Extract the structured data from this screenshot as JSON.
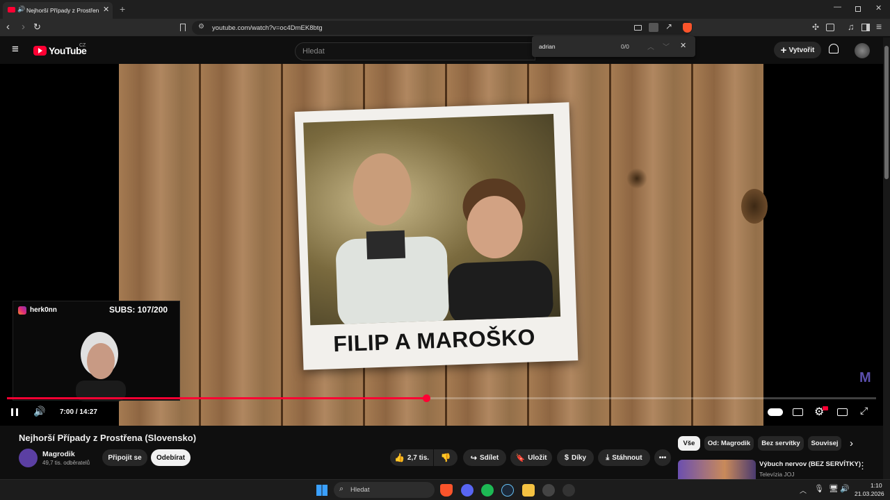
{
  "browser": {
    "tab_title": "Nejhorší Případy z Prostřena",
    "url": "youtube.com/watch?v=oc4DmEK8btg"
  },
  "find_bar": {
    "query": "adrian",
    "count": "0/0"
  },
  "youtube": {
    "logo_text": "YouTube",
    "region": "CZ",
    "search_placeholder": "Hledat",
    "create_label": "Vytvořit"
  },
  "video": {
    "card_caption": "FILIP A MAROŠKO",
    "time": "7:00 / 14:27",
    "progress": 0.482,
    "title": "Nejhorší Případy z Prostřena (Slovensko)"
  },
  "overlay": {
    "streamer": "herk0nn",
    "subs": "SUBS: 107/200"
  },
  "channel": {
    "name": "Magrodik",
    "subscribers": "49,7 tis. odběratelů",
    "join_label": "Připojit se",
    "subscribe_label": "Odebírat"
  },
  "actions": {
    "likes": "2,7 tis.",
    "share": "Sdílet",
    "save": "Uložit",
    "thanks": "Díky",
    "download": "Stáhnout"
  },
  "chips": [
    "Vše",
    "Od: Magrodik",
    "Bez servítky",
    "Souvisej"
  ],
  "recommendation": {
    "title": "Výbuch nervov (BEZ SERVÍTKY)",
    "channel": "Televízia JOJ"
  },
  "taskbar": {
    "search_placeholder": "Hledat",
    "time": "1:10",
    "date": "21.03.2026"
  },
  "colors": {
    "accent_red": "#ff0033",
    "background": "#0f0f0f"
  }
}
